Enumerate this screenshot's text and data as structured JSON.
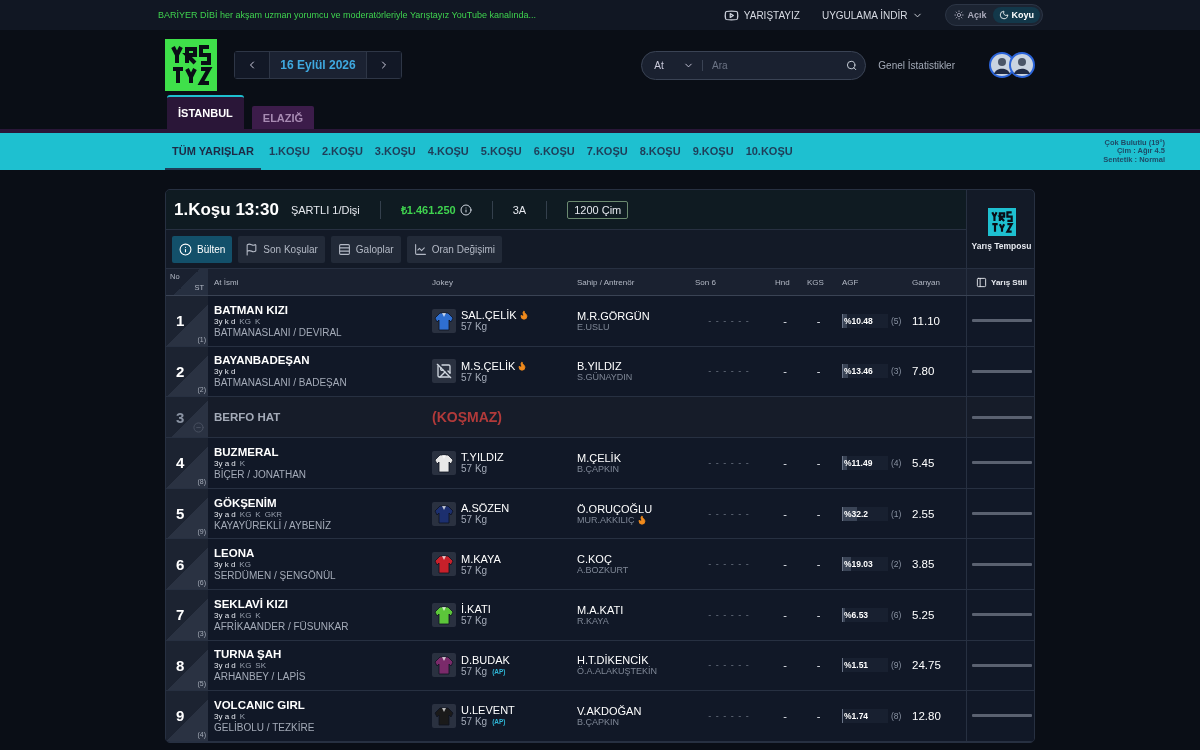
{
  "announcement": "BARİYER DİBİ her akşam uzman yorumcu ve moderatörleriyle Yarıştayız YouTube kanalında...",
  "top_links": {
    "youtube": "YARIŞTAYIZ",
    "app": "UYGULAMA İNDİR"
  },
  "theme_toggle": [
    {
      "label": "Açık",
      "kind": "sun",
      "selected": false
    },
    {
      "label": "Koyu",
      "kind": "moon",
      "selected": true
    }
  ],
  "date": "16 Eylül 2026",
  "search": {
    "filter": "At",
    "placeholder": "Ara"
  },
  "stats_link": "Genel İstatistikler",
  "cities": [
    {
      "label": "İSTANBUL",
      "selected": true
    },
    {
      "label": "ELAZIĞ",
      "selected": false
    }
  ],
  "races": [
    {
      "label": "TÜM YARIŞLAR",
      "selected": true
    },
    {
      "label": "1.KOŞU",
      "selected": false
    },
    {
      "label": "2.KOŞU",
      "selected": false
    },
    {
      "label": "3.KOŞU",
      "selected": false
    },
    {
      "label": "4.KOŞU",
      "selected": false
    },
    {
      "label": "5.KOŞU",
      "selected": false
    },
    {
      "label": "6.KOŞU",
      "selected": false
    },
    {
      "label": "7.KOŞU",
      "selected": false
    },
    {
      "label": "8.KOŞU",
      "selected": false
    },
    {
      "label": "9.KOŞU",
      "selected": false
    },
    {
      "label": "10.KOŞU",
      "selected": false
    }
  ],
  "weather": [
    "Çok Bulutlu (19°)",
    "Çim : Ağır 4.5",
    "Sentetik : Normal"
  ],
  "race": {
    "title": "1.Koşu 13:30",
    "condition": "ŞARTLI 1/Dişi",
    "prize": "₺1.461.250",
    "group": "3A",
    "track": "1200 Çim"
  },
  "view_tabs": [
    {
      "label": "Bülten",
      "kind": "info",
      "selected": true
    },
    {
      "label": "Son Koşular",
      "kind": "flag",
      "selected": false
    },
    {
      "label": "Galoplar",
      "kind": "track",
      "selected": false
    },
    {
      "label": "Oran Değişimi",
      "kind": "chart",
      "selected": false
    }
  ],
  "tempo_label": "Yarış Temposu",
  "table": {
    "columns": {
      "no": "No",
      "st": "ST",
      "name": "At İsmi",
      "jockey": "Jokey",
      "owner": "Sahip / Antrenör",
      "son6": "Son 6",
      "hnd": "Hnd",
      "kgs": "KGS",
      "agf": "AGF",
      "ganyan": "Ganyan",
      "style": "Yarış Stili"
    },
    "rows": [
      {
        "no": "1",
        "start": "(1)",
        "scratched": false,
        "name": "BATMAN KIZI",
        "info": "3y k d",
        "tags": [
          "KG",
          "K"
        ],
        "pedigree": "BATMANASLANI / DEVIRAL",
        "jockey": {
          "name": "SAL.ÇELİK",
          "hot": true,
          "weight": "57 Kg",
          "color": "#2f6fd0"
        },
        "owner": "M.R.GÖRGÜN",
        "trainer": {
          "name": "E.USLU",
          "hot": false
        },
        "son6": "- - - - - -",
        "hnd": "-",
        "kgs": "-",
        "agf": "%10.48",
        "agf_rank": "(5)",
        "level": 0.1048,
        "ganyan": "11.10"
      },
      {
        "no": "2",
        "start": "(2)",
        "scratched": false,
        "name": "BAYANBADEŞAN",
        "info": "3y k d",
        "pedigree": "BATMANASLANI / BADEŞAN",
        "jockey": {
          "name": "M.S.ÇELİK",
          "hot": true,
          "weight": "57 Kg"
        },
        "owner": "B.YILDIZ",
        "trainer": {
          "name": "S.GÜNAYDIN",
          "hot": false
        },
        "son6": "- - - - - -",
        "hnd": "-",
        "kgs": "-",
        "agf": "%13.46",
        "agf_rank": "(3)",
        "level": 0.1346,
        "ganyan": "7.80"
      },
      {
        "no": "3",
        "scratched": true,
        "name": "BERFO HAT",
        "note": "(KOŞMAZ)"
      },
      {
        "no": "4",
        "start": "(8)",
        "scratched": false,
        "name": "BUZMERAL",
        "info": "3y a d",
        "tags": [
          "K"
        ],
        "pedigree": "BİÇER / JONATHAN",
        "jockey": {
          "name": "T.YILDIZ",
          "hot": false,
          "weight": "57 Kg",
          "color": "#e8e8e8"
        },
        "owner": "M.ÇELİK",
        "trainer": {
          "name": "B.ÇAPKIN",
          "hot": false
        },
        "son6": "- - - - - -",
        "hnd": "-",
        "kgs": "-",
        "agf": "%11.49",
        "agf_rank": "(4)",
        "level": 0.1149,
        "ganyan": "5.45"
      },
      {
        "no": "5",
        "start": "(9)",
        "scratched": false,
        "name": "GÖKŞENİM",
        "info": "3y a d",
        "tags": [
          "KG",
          "K",
          "GKR"
        ],
        "pedigree": "KAYAYÜREKLİ / AYBENİZ",
        "jockey": {
          "name": "A.SÖZEN",
          "hot": false,
          "weight": "57 Kg",
          "color": "#1c2f6e"
        },
        "owner": "Ö.ORUÇOĞLU",
        "trainer": {
          "name": "MUR.AKKILIÇ",
          "hot": true
        },
        "son6": "- - - - - -",
        "hnd": "-",
        "kgs": "-",
        "agf": "%32.2",
        "agf_rank": "(1)",
        "level": 0.322,
        "ganyan": "2.55"
      },
      {
        "no": "6",
        "start": "(6)",
        "scratched": false,
        "name": "LEONA",
        "info": "3y k d",
        "tags": [
          "KG"
        ],
        "pedigree": "SERDÜMEN / ŞENGÖNÜL",
        "jockey": {
          "name": "M.KAYA",
          "hot": false,
          "weight": "57 Kg",
          "color": "#c8202a"
        },
        "owner": "C.KOÇ",
        "trainer": {
          "name": "A.BOZKURT",
          "hot": false
        },
        "son6": "- - - - - -",
        "hnd": "-",
        "kgs": "-",
        "agf": "%19.03",
        "agf_rank": "(2)",
        "level": 0.1903,
        "ganyan": "3.85"
      },
      {
        "no": "7",
        "start": "(3)",
        "scratched": false,
        "name": "SEKLAVİ KIZI",
        "info": "3y a d",
        "tags": [
          "KG",
          "K"
        ],
        "pedigree": "AFRİKAANDER / FÜSUNKAR",
        "jockey": {
          "name": "İ.KATI",
          "hot": false,
          "weight": "57 Kg",
          "color": "#5cc63a"
        },
        "owner": "M.A.KATI",
        "trainer": {
          "name": "R.KAYA",
          "hot": false
        },
        "son6": "- - - - - -",
        "hnd": "-",
        "kgs": "-",
        "agf": "%6.53",
        "agf_rank": "(6)",
        "level": 0.0653,
        "ganyan": "5.25"
      },
      {
        "no": "8",
        "start": "(5)",
        "scratched": false,
        "name": "TURNA ŞAH",
        "info": "3y d d",
        "tags": [
          "KG",
          "SK"
        ],
        "pedigree": "ARHANBEY / LAPİS",
        "jockey": {
          "name": "D.BUDAK",
          "hot": false,
          "weight": "57 Kg",
          "apprentice": "(AP)",
          "color": "#7a2a6a"
        },
        "owner": "H.T.DİKENCİK",
        "trainer": {
          "name": "Ö.A.ALAKUŞTEKİN",
          "hot": false
        },
        "son6": "- - - - - -",
        "hnd": "-",
        "kgs": "-",
        "agf": "%1.51",
        "agf_rank": "(9)",
        "level": 0.0151,
        "ganyan": "24.75"
      },
      {
        "no": "9",
        "start": "(4)",
        "scratched": false,
        "name": "VOLCANIC GIRL",
        "info": "3y a d",
        "tags": [
          "K"
        ],
        "pedigree": "GELİBOLU / TEZKİRE",
        "jockey": {
          "name": "U.LEVENT",
          "hot": false,
          "weight": "57 Kg",
          "apprentice": "(AP)",
          "color": "#1a1a1a"
        },
        "owner": "V.AKDOĞAN",
        "trainer": {
          "name": "B.ÇAPKIN",
          "hot": false
        },
        "son6": "- - - - - -",
        "hnd": "-",
        "kgs": "-",
        "agf": "%1.74",
        "agf_rank": "(8)",
        "level": 0.0174,
        "ganyan": "12.80"
      }
    ]
  }
}
